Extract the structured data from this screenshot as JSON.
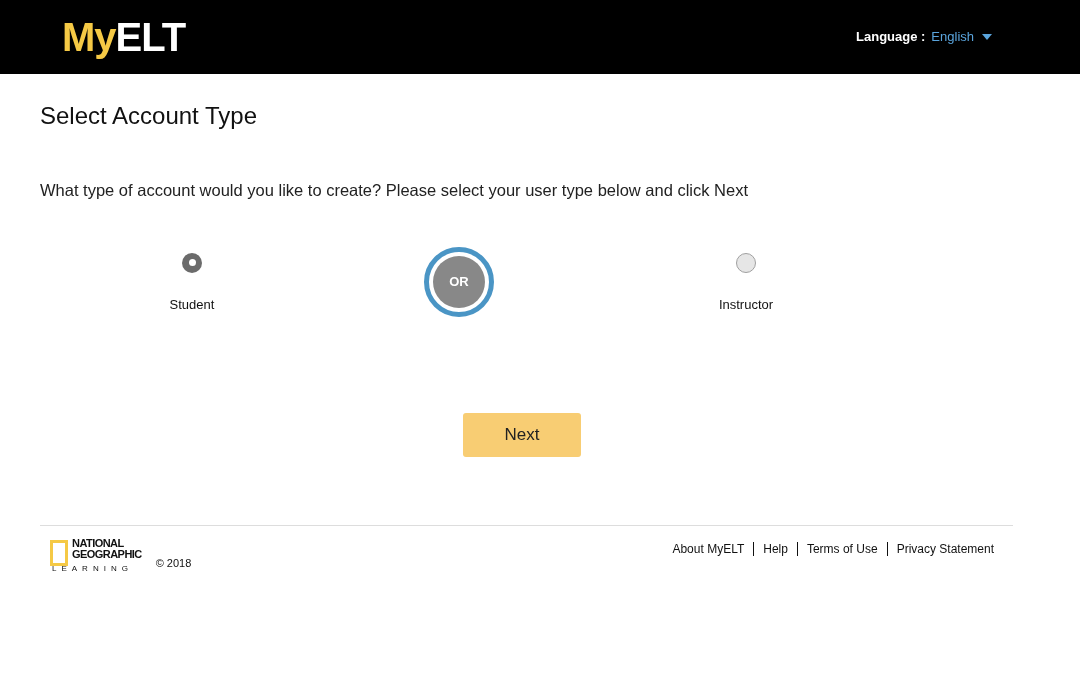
{
  "header": {
    "logo": {
      "first": "My",
      "second": "ELT"
    },
    "language_label": "Language :",
    "language_value": "English"
  },
  "title": "Select Account Type",
  "prompt": "What type of account would you like to create? Please select your user type below and click Next",
  "options": [
    {
      "label": "Student",
      "selected": true
    },
    {
      "label": "Instructor",
      "selected": false
    }
  ],
  "divider_text": "OR",
  "next_button": "Next",
  "footer": {
    "brand": {
      "line_1": "NATIONAL",
      "line_2": "GEOGRAPHIC",
      "line_3": "LEARNING"
    },
    "copyright": "© 2018",
    "links": [
      "About MyELT",
      "Help",
      "Terms of Use",
      "Privacy Statement"
    ]
  }
}
